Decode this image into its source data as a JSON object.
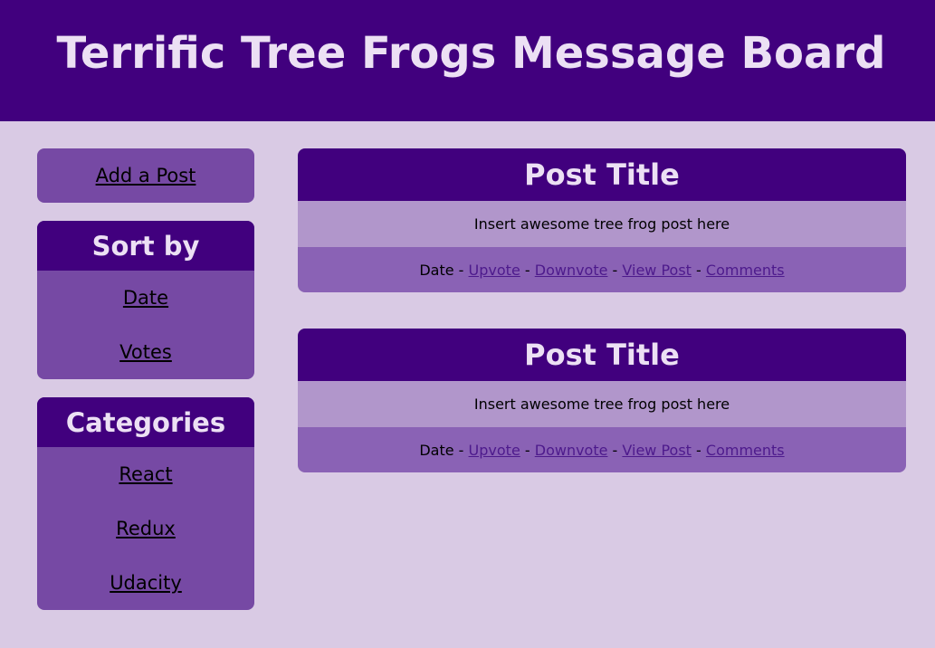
{
  "header": {
    "title": "Terrific Tree Frogs Message Board"
  },
  "sidebar": {
    "add_post_label": "Add a Post",
    "sort": {
      "heading": "Sort by",
      "items": [
        {
          "label": "Date"
        },
        {
          "label": "Votes"
        }
      ]
    },
    "categories": {
      "heading": "Categories",
      "items": [
        {
          "label": "React"
        },
        {
          "label": "Redux"
        },
        {
          "label": "Udacity"
        }
      ]
    }
  },
  "posts": [
    {
      "title": "Post Title",
      "body": "Insert awesome tree frog post here",
      "date": "Date",
      "separator": " - ",
      "upvote": "Upvote",
      "downvote": "Downvote",
      "view": "View Post",
      "comments": "Comments"
    },
    {
      "title": "Post Title",
      "body": "Insert awesome tree frog post here",
      "date": "Date",
      "separator": " - ",
      "upvote": "Upvote",
      "downvote": "Downvote",
      "view": "View Post",
      "comments": "Comments"
    }
  ],
  "colors": {
    "header_bg": "#41007e",
    "page_bg": "#d9cae4",
    "sidebar_box": "#7649a4",
    "post_body": "#b196cb",
    "post_footer": "#8a62b5",
    "title_text": "#ece0f4",
    "link": "#4d1a8c"
  }
}
